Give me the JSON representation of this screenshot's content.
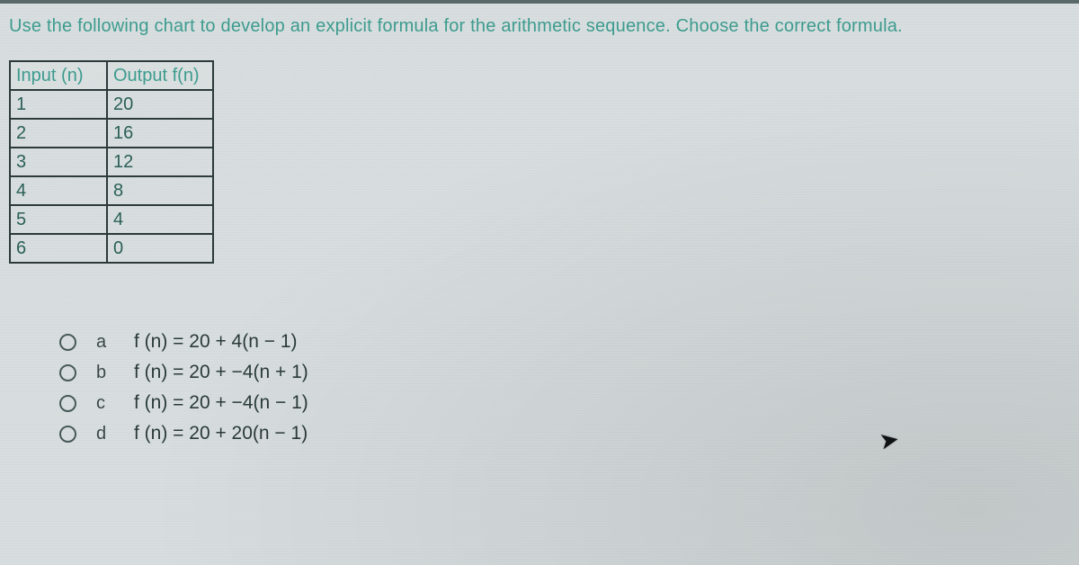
{
  "question": "Use the following chart to develop an explicit formula for the arithmetic sequence. Choose the correct formula.",
  "table": {
    "headers": {
      "input": "Input (n)",
      "output": "Output f(n)"
    },
    "rows": [
      {
        "n": "1",
        "fn": "20"
      },
      {
        "n": "2",
        "fn": "16"
      },
      {
        "n": "3",
        "fn": "12"
      },
      {
        "n": "4",
        "fn": "8"
      },
      {
        "n": "5",
        "fn": "4"
      },
      {
        "n": "6",
        "fn": "0"
      }
    ]
  },
  "options": [
    {
      "letter": "a",
      "formula": "f (n) = 20 + 4(n − 1)"
    },
    {
      "letter": "b",
      "formula": "f (n) = 20 + −4(n + 1)"
    },
    {
      "letter": "c",
      "formula": "f (n) = 20 + −4(n − 1)"
    },
    {
      "letter": "d",
      "formula": "f (n) = 20 + 20(n − 1)"
    }
  ],
  "chart_data": {
    "type": "table",
    "title": "Arithmetic sequence input/output",
    "columns": [
      "Input (n)",
      "Output f(n)"
    ],
    "rows": [
      [
        1,
        20
      ],
      [
        2,
        16
      ],
      [
        3,
        12
      ],
      [
        4,
        8
      ],
      [
        5,
        4
      ],
      [
        6,
        0
      ]
    ]
  }
}
